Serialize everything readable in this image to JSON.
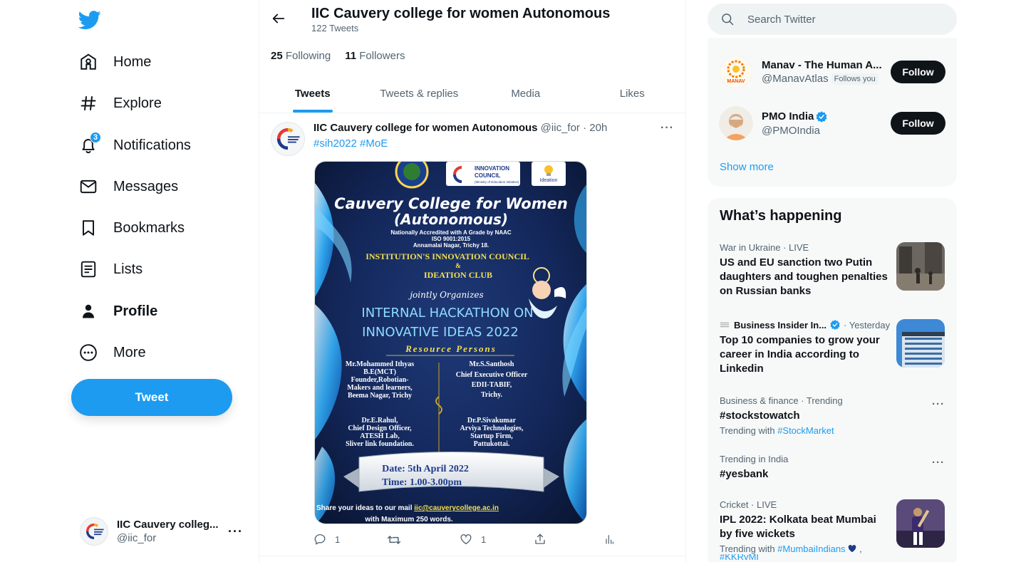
{
  "nav": {
    "items": [
      {
        "label": "Home",
        "icon": "home-icon"
      },
      {
        "label": "Explore",
        "icon": "hashtag-icon"
      },
      {
        "label": "Notifications",
        "icon": "bell-icon",
        "badge": "3"
      },
      {
        "label": "Messages",
        "icon": "mail-icon"
      },
      {
        "label": "Bookmarks",
        "icon": "bookmark-icon"
      },
      {
        "label": "Lists",
        "icon": "list-icon"
      },
      {
        "label": "Profile",
        "icon": "person-icon",
        "active": true
      },
      {
        "label": "More",
        "icon": "more-circle-icon"
      }
    ],
    "tweet_button": "Tweet"
  },
  "account": {
    "name": "IIC Cauvery colleg...",
    "handle": "@iic_for"
  },
  "profile_header": {
    "title": "IIC Cauvery college for women Autonomous",
    "tweet_count": "122 Tweets"
  },
  "profile": {
    "following_count": "25",
    "following_label": "Following",
    "followers_count": "11",
    "followers_label": "Followers"
  },
  "tabs": [
    "Tweets",
    "Tweets & replies",
    "Media",
    "Likes"
  ],
  "tweet": {
    "name": "IIC Cauvery college for women Autonomous",
    "handle": "@iic_for",
    "time": "· 20h",
    "hashtags": "#sih2022 #MoE",
    "replies": "1",
    "likes": "1",
    "poster": {
      "logo_line1": "INSTITUTION'S",
      "logo_line2": "INNOVATION",
      "logo_line3": "COUNCIL",
      "logo_line4": "(Ministry of Education Initiative)",
      "ideation": "Ideation",
      "title1": "Cauvery College for Women",
      "title2": "(Autonomous)",
      "accr1": "Nationally Accredited with A Grade by NAAC",
      "accr2": "ISO 9001:2015",
      "accr3": "Annamalai Nagar, Trichy 18.",
      "council": "INSTITUTION'S INNOVATION COUNCIL",
      "amp": "&",
      "club": "IDEATION CLUB",
      "jointly": "jointly Organizes",
      "event1": "INTERNAL HACKATHON ON",
      "event2": "INNOVATIVE IDEAS 2022",
      "resource": "Resource Persons",
      "p1": [
        "Mr.Mohammed Ithyas",
        "B.E(MCT)",
        "Founder,Robotian-",
        "Makers and learners,",
        "Beema Nagar, Trichy"
      ],
      "p2": [
        "Mr.S.Santhosh",
        "Chief Executive Officer",
        "EDII-TABIF,",
        "Trichy."
      ],
      "p3": [
        "Dr.E.Rahul,",
        "Chief Design Officer,",
        "ATESH Lab,",
        "Sliver link foundation."
      ],
      "p4": [
        "Dr.P.Sivakumar",
        "Arviya Technologies,",
        "Startup Firm,",
        "Pattukottai."
      ],
      "date": "Date: 5th April 2022",
      "time": "Time: 1.00-3.00pm",
      "share_prefix": "Share your ideas to our mail ",
      "share_email": "iic@cauverycollege.ac.in",
      "share_suffix": "with Maximum 250 words."
    }
  },
  "search": {
    "placeholder": "Search Twitter"
  },
  "who_to_follow": [
    {
      "name": "Manav - The Human A...",
      "handle": "@ManavAtlas",
      "follows_you": "Follows you",
      "button": "Follow",
      "avatar_text": "MANAV"
    },
    {
      "name": "PMO India",
      "handle": "@PMOIndia",
      "verified": true,
      "button": "Follow"
    }
  ],
  "show_more": "Show more",
  "trends": {
    "title": "What’s happening",
    "items": [
      {
        "meta": "War in Ukraine · LIVE",
        "title": "US and EU sanction two Putin daughters and toughen penalties on Russian banks"
      },
      {
        "source": "Business Insider In...",
        "meta": "· Yesterday",
        "title": "Top 10 companies to grow your career in India according to Linkedin"
      },
      {
        "meta": "Business & finance · Trending",
        "title": "#stockstowatch",
        "with_prefix": "Trending with ",
        "with_link": "#StockMarket"
      },
      {
        "meta": "Trending in India",
        "title": "#yesbank"
      },
      {
        "meta": "Cricket · LIVE",
        "title": "IPL 2022: Kolkata beat Mumbai by five wickets",
        "with_prefix": "Trending with ",
        "with_link": "#MumbaiIndians",
        "with_suffix": " ,",
        "cut_link": "#KKRvMI"
      }
    ]
  },
  "colors": {
    "accent": "#1d9bf0",
    "text": "#0f1419",
    "secondary": "#536471",
    "panel": "#f7f9f9"
  }
}
